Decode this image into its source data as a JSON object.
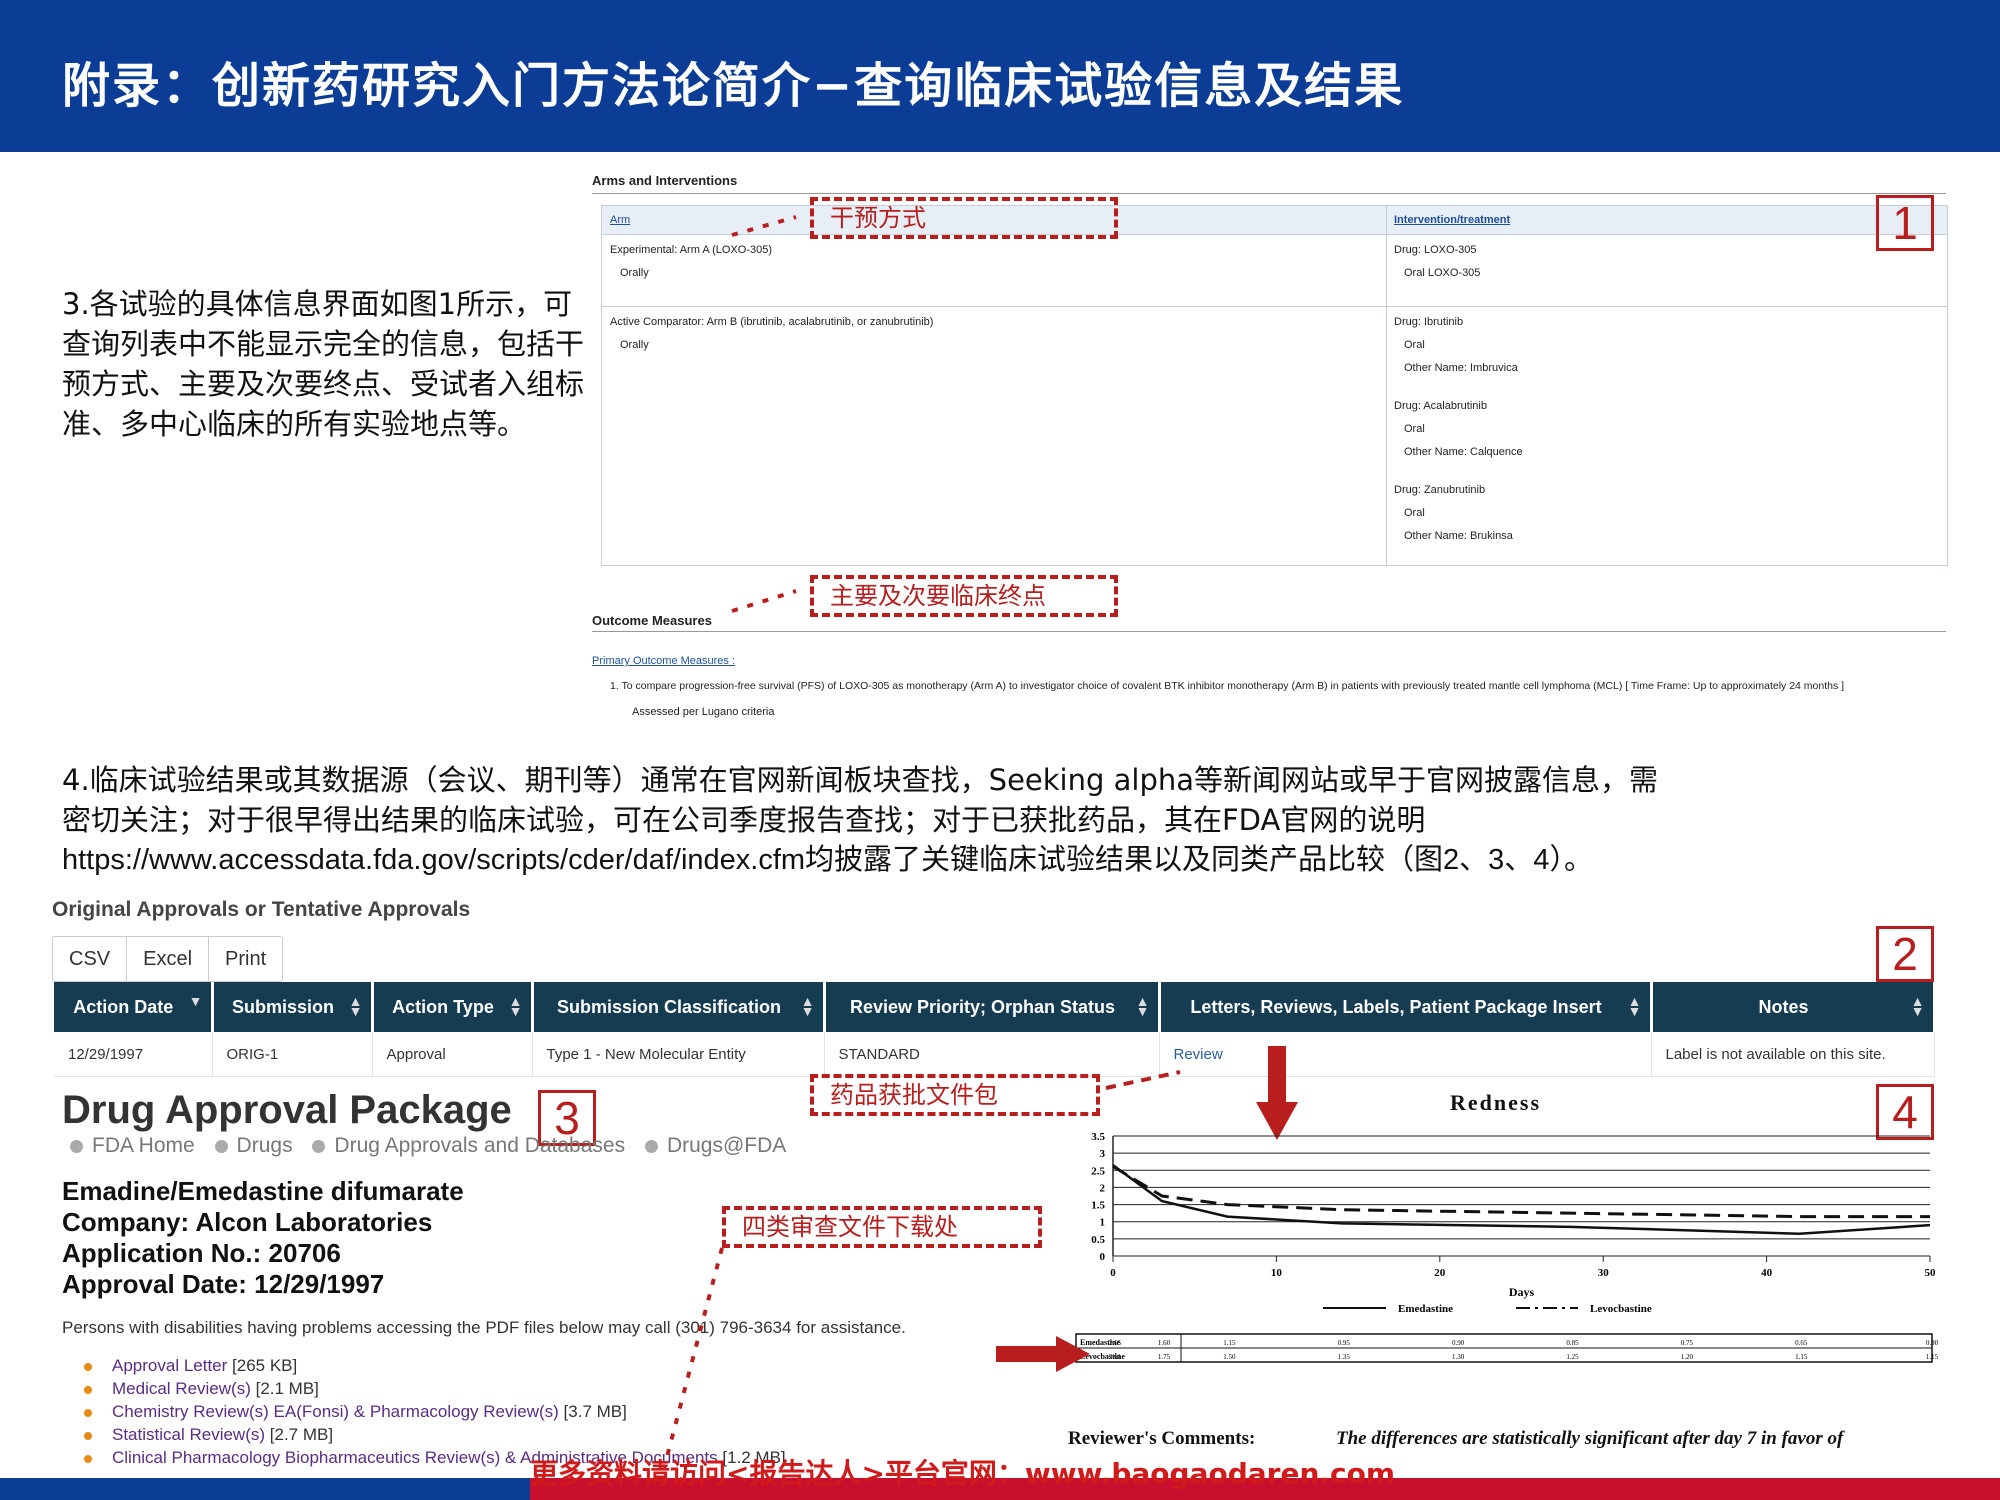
{
  "header": {
    "title": "附录：创新药研究入门方法论简介−查询临床试验信息及结果"
  },
  "section3": {
    "text": "3.各试验的具体信息界面如图1所示，可查询列表中不能显示完全的信息，包括干预方式、主要及次要终点、受试者入组标准、多中心临床的所有实验地点等。"
  },
  "trial": {
    "arms_heading": "Arms and Interventions",
    "col_arm": "Arm",
    "col_intervention": "Intervention/treatment",
    "arm_a": "Experimental: Arm A (LOXO-305)",
    "arm_a_route": "Orally",
    "arm_a_drug": "Drug: LOXO-305",
    "arm_a_drug_detail": "Oral LOXO-305",
    "arm_b": "Active Comparator: Arm B (ibrutinib, acalabrutinib, or zanubrutinib)",
    "arm_b_route": "Orally",
    "drugs_b": [
      {
        "drug": "Drug: Ibrutinib",
        "route": "Oral",
        "other": "Other Name: Imbruvica"
      },
      {
        "drug": "Drug: Acalabrutinib",
        "route": "Oral",
        "other": "Other Name: Calquence"
      },
      {
        "drug": "Drug: Zanubrutinib",
        "route": "Oral",
        "other": "Other Name: Brukinsa"
      }
    ],
    "outcome_heading": "Outcome Measures",
    "primary_label": "Primary Outcome Measures :",
    "primary_1": "1. To compare progression-free survival (PFS) of LOXO-305 as monotherapy (Arm A) to investigator choice of covalent BTK inhibitor monotherapy (Arm B) in patients with previously treated mantle cell lymphoma (MCL) [ Time Frame: Up to approximately 24 months ]",
    "primary_1_sub": "Assessed per Lugano criteria",
    "callout_intervention": "干预方式",
    "callout_endpoints": "主要及次要临床终点",
    "fig_no": "1"
  },
  "section4": {
    "line1": "4.临床试验结果或其数据源（会议、期刊等）通常在官网新闻板块查找，Seeking alpha等新闻网站或早于官网披露信息，需",
    "line2": "密切关注；对于很早得出结果的临床试验，可在公司季度报告查找；对于已获批药品，其在FDA官网的说明",
    "line3": "https://www.accessdata.fda.gov/scripts/cder/daf/index.cfm均披露了关键临床试验结果以及同类产品比较（图2、3、4）。"
  },
  "approvals": {
    "title": "Original Approvals or Tentative Approvals",
    "buttons": [
      "CSV",
      "Excel",
      "Print"
    ],
    "headers": [
      "Action Date",
      "Submission",
      "Action Type",
      "Submission Classification",
      "Review Priority; Orphan Status",
      "Letters, Reviews, Labels, Patient Package Insert",
      "Notes"
    ],
    "row": [
      "12/29/1997",
      "ORIG-1",
      "Approval",
      "Type 1 - New Molecular Entity",
      "STANDARD",
      "Review",
      "Label is not available on this site."
    ],
    "fig_no": "2"
  },
  "package": {
    "title": "Drug Approval Package",
    "breadcrumb": [
      "FDA Home",
      "Drugs",
      "Drug Approvals and Databases",
      "Drugs@FDA"
    ],
    "drug": "Emadine/Emedastine difumarate",
    "company": "Company: Alcon Laboratories",
    "app_no": "Application No.:  20706",
    "approval_date": "Approval Date: 12/29/1997",
    "note": "Persons with disabilities having problems accessing the PDF files below may call (301) 796-3634 for assistance.",
    "docs": [
      {
        "link": "Approval Letter",
        "size": " [265 KB]"
      },
      {
        "link": "Medical Review(s)",
        "size": " [2.1 MB]"
      },
      {
        "link": "Chemistry Review(s) EA(Fonsi) & Pharmacology Review(s)",
        "size": " [3.7 MB]"
      },
      {
        "link": "Statistical Review(s)",
        "size": " [2.7 MB]"
      },
      {
        "link": "Clinical Pharmacology Biopharmaceutics Review(s) & Administrative Documents",
        "size": " [1.2 MB]"
      }
    ],
    "callout_package": "药品获批文件包",
    "callout_reviews": "四类审查文件下载处",
    "fig_no": "3"
  },
  "chart_data": {
    "type": "line",
    "title": "Redness",
    "xlabel": "Days",
    "ylabel": "",
    "xlim": [
      0,
      50
    ],
    "ylim": [
      0,
      3.5
    ],
    "x_ticks": [
      0,
      10,
      20,
      30,
      40,
      50
    ],
    "y_ticks": [
      0,
      0.5,
      1,
      1.5,
      2,
      2.5,
      3,
      3.5
    ],
    "series": [
      {
        "name": "Emedastine",
        "x": [
          0,
          3,
          7,
          14,
          21,
          28,
          35,
          42,
          50
        ],
        "y": [
          2.65,
          1.6,
          1.15,
          0.95,
          0.9,
          0.85,
          0.75,
          0.65,
          0.9
        ]
      },
      {
        "name": "Levocbastine",
        "x": [
          0,
          3,
          7,
          14,
          21,
          28,
          35,
          42,
          50
        ],
        "y": [
          2.61,
          1.75,
          1.5,
          1.35,
          1.3,
          1.25,
          1.2,
          1.15,
          1.15
        ]
      }
    ],
    "reviewer_label": "Reviewer's Comments:",
    "reviewer_comment": "The differences are statistically significant after day 7 in favor of",
    "fig_no": "4"
  },
  "footer": {
    "text": "更多资料请访问<报告达人>平台官网：www.baogaodaren.com"
  },
  "colors": {
    "header_blue": "#0b3c96",
    "accent_red": "#b81e1e",
    "table_header": "#163c52"
  }
}
